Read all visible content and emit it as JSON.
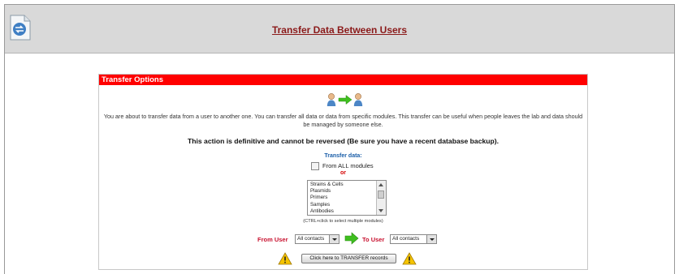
{
  "header": {
    "title": "Transfer Data Between Users",
    "icon": "transfer-document-icon"
  },
  "panel": {
    "title": "Transfer Options",
    "graphic_icons": [
      "user-icon",
      "arrow-right-icon",
      "user-icon"
    ],
    "description": "You are about to transfer data from a user to another one. You can transfer all data or data from specific modules. This transfer can be useful when people leaves the lab and data should be managed by someone else.",
    "warning": "This action is definitive and cannot be reversed (Be sure you have a recent database backup).",
    "transfer_label": "Transfer data:",
    "all_modules_label": "From ALL modules",
    "all_modules_checked": false,
    "or_label": "or",
    "modules": [
      "Strains & Cells",
      "Plasmids",
      "Primers",
      "Samples",
      "Antibodies"
    ],
    "multi_select_hint": "(CTRL+click to select multiple modules)",
    "from_user_label": "From User",
    "from_user_value": "All contacts",
    "to_user_label": "To User",
    "to_user_value": "All contacts",
    "transfer_button": "Click here to TRANSFER records"
  },
  "colors": {
    "header_bg": "#d9d9d9",
    "title_color": "#8b1a1a",
    "panel_header_bg": "#ff0000",
    "user_label_color": "#c8102e",
    "transfer_label_color": "#1a5ea8",
    "arrow_green": "#3fbf1f",
    "warning_yellow": "#f5c400"
  }
}
